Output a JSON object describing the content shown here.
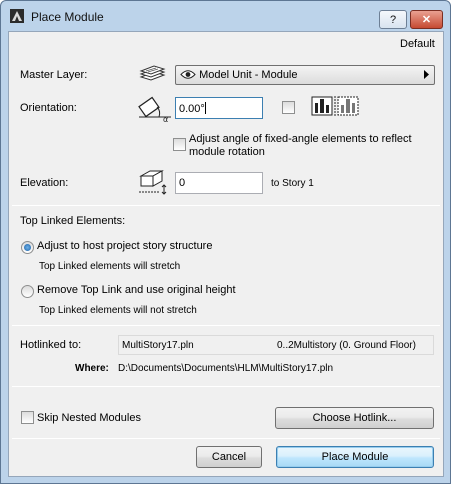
{
  "window": {
    "title": "Place Module"
  },
  "titlebar": {
    "help_label": "?",
    "close_label": "✕"
  },
  "preset": "Default",
  "master_layer": {
    "label": "Master Layer:",
    "value": "Model Unit - Module"
  },
  "orientation": {
    "label": "Orientation:",
    "value": "0.00°",
    "adjust_label_line1": "Adjust angle of fixed-angle elements to reflect",
    "adjust_label_line2": "module rotation"
  },
  "elevation": {
    "label": "Elevation:",
    "value": "0",
    "reference": "to Story 1"
  },
  "top_linked": {
    "heading": "Top Linked Elements:",
    "options": [
      {
        "label": "Adjust to host project story structure",
        "note": "Top Linked elements will stretch",
        "checked": true
      },
      {
        "label": "Remove Top Link and use original height",
        "note": "Top Linked elements will not stretch",
        "checked": false
      }
    ]
  },
  "hotlink": {
    "label": "Hotlinked to:",
    "file": "MultiStory17.pln",
    "story": "0..2Multistory (0. Ground Floor)",
    "where_label": "Where:",
    "where_path": "D:\\Documents\\Documents\\HLM\\MultiStory17.pln"
  },
  "skip_nested": {
    "label": "Skip Nested Modules"
  },
  "buttons": {
    "choose_hotlink": "Choose Hotlink...",
    "cancel": "Cancel",
    "place": "Place Module"
  }
}
